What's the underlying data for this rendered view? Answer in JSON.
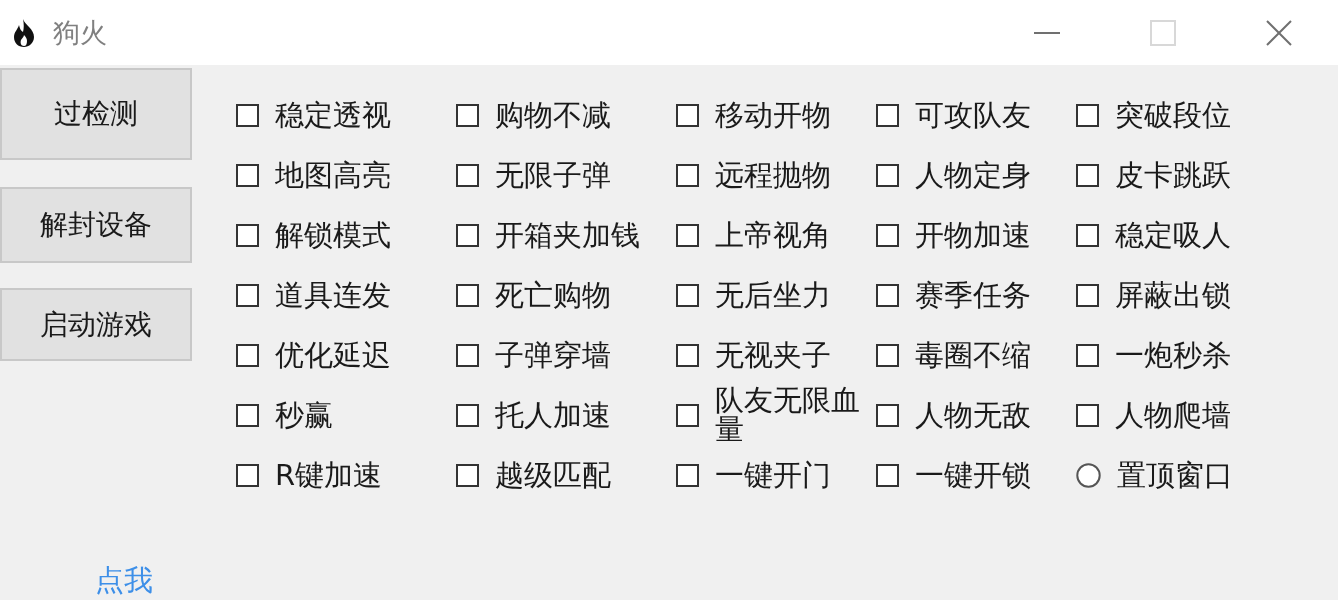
{
  "window": {
    "title": "狗火",
    "controls": [
      {
        "kind": "minimize",
        "disabled": false
      },
      {
        "kind": "maximize",
        "disabled": true
      },
      {
        "kind": "close",
        "disabled": false
      }
    ]
  },
  "buttons": [
    "过检测",
    "解封设备",
    "启动游戏"
  ],
  "options": [
    {
      "label": "稳定透视",
      "kind": "checkbox",
      "checked": false
    },
    {
      "label": "购物不减",
      "kind": "checkbox",
      "checked": false
    },
    {
      "label": "移动开物",
      "kind": "checkbox",
      "checked": false
    },
    {
      "label": "可攻队友",
      "kind": "checkbox",
      "checked": false
    },
    {
      "label": "突破段位",
      "kind": "checkbox",
      "checked": false
    },
    {
      "label": "地图高亮",
      "kind": "checkbox",
      "checked": false
    },
    {
      "label": "无限子弹",
      "kind": "checkbox",
      "checked": false
    },
    {
      "label": "远程抛物",
      "kind": "checkbox",
      "checked": false
    },
    {
      "label": "人物定身",
      "kind": "checkbox",
      "checked": false
    },
    {
      "label": "皮卡跳跃",
      "kind": "checkbox",
      "checked": false
    },
    {
      "label": "解锁模式",
      "kind": "checkbox",
      "checked": false
    },
    {
      "label": "开箱夹加钱",
      "kind": "checkbox",
      "checked": false
    },
    {
      "label": "上帝视角",
      "kind": "checkbox",
      "checked": false
    },
    {
      "label": "开物加速",
      "kind": "checkbox",
      "checked": false
    },
    {
      "label": "稳定吸人",
      "kind": "checkbox",
      "checked": false
    },
    {
      "label": "道具连发",
      "kind": "checkbox",
      "checked": false
    },
    {
      "label": "死亡购物",
      "kind": "checkbox",
      "checked": false
    },
    {
      "label": "无后坐力",
      "kind": "checkbox",
      "checked": false
    },
    {
      "label": "赛季任务",
      "kind": "checkbox",
      "checked": false
    },
    {
      "label": "屏蔽出锁",
      "kind": "checkbox",
      "checked": false
    },
    {
      "label": "优化延迟",
      "kind": "checkbox",
      "checked": false
    },
    {
      "label": "子弹穿墙",
      "kind": "checkbox",
      "checked": false
    },
    {
      "label": "无视夹子",
      "kind": "checkbox",
      "checked": false
    },
    {
      "label": "毒圈不缩",
      "kind": "checkbox",
      "checked": false
    },
    {
      "label": "一炮秒杀",
      "kind": "checkbox",
      "checked": false
    },
    {
      "label": "秒赢",
      "kind": "checkbox",
      "checked": false
    },
    {
      "label": "托人加速",
      "kind": "checkbox",
      "checked": false
    },
    {
      "label": "队友无限血量",
      "kind": "checkbox",
      "checked": false
    },
    {
      "label": "人物无敌",
      "kind": "checkbox",
      "checked": false
    },
    {
      "label": "人物爬墙",
      "kind": "checkbox",
      "checked": false
    },
    {
      "label": "R键加速",
      "kind": "checkbox",
      "checked": false
    },
    {
      "label": "越级匹配",
      "kind": "checkbox",
      "checked": false
    },
    {
      "label": "一键开门",
      "kind": "checkbox",
      "checked": false
    },
    {
      "label": "一键开锁",
      "kind": "checkbox",
      "checked": false
    },
    {
      "label": "置顶窗口",
      "kind": "radio",
      "checked": false
    }
  ],
  "link": "点我"
}
